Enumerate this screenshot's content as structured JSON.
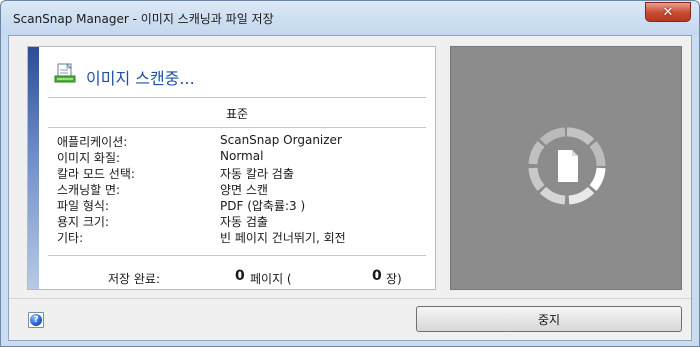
{
  "window": {
    "title": "ScanSnap Manager - 이미지 스캐닝과 파일 저장",
    "close_icon": "close-icon"
  },
  "status": {
    "icon": "scan-document-icon",
    "title": "이미지 스캔중..."
  },
  "profile": {
    "name": "표준"
  },
  "settings": [
    {
      "label": "애플리케이션:",
      "value": "ScanSnap Organizer"
    },
    {
      "label": "이미지 화질:",
      "value": "Normal"
    },
    {
      "label": "칼라 모드 선택:",
      "value": "자동 칼라 검출"
    },
    {
      "label": "스캐닝할 면:",
      "value": "양면 스캔"
    },
    {
      "label": "파일 형식:",
      "value": "PDF (압축률:3 )"
    },
    {
      "label": "용지 크기:",
      "value": "자동 검출"
    },
    {
      "label": "기타:",
      "value": "빈 페이지 건너뛰기, 회전"
    }
  ],
  "saved": {
    "label": "저장 완료:",
    "pages": "0",
    "pages_unit": "페이지 (",
    "sheets": "0",
    "sheets_unit": "장)"
  },
  "preview": {
    "icon": "loading-spinner-icon",
    "background": "#8c8c8c"
  },
  "buttons": {
    "help_icon": "help-icon",
    "stop_label": "중지"
  },
  "colors": {
    "accent": "#1f4fa8",
    "close_button": "#c94a32"
  }
}
